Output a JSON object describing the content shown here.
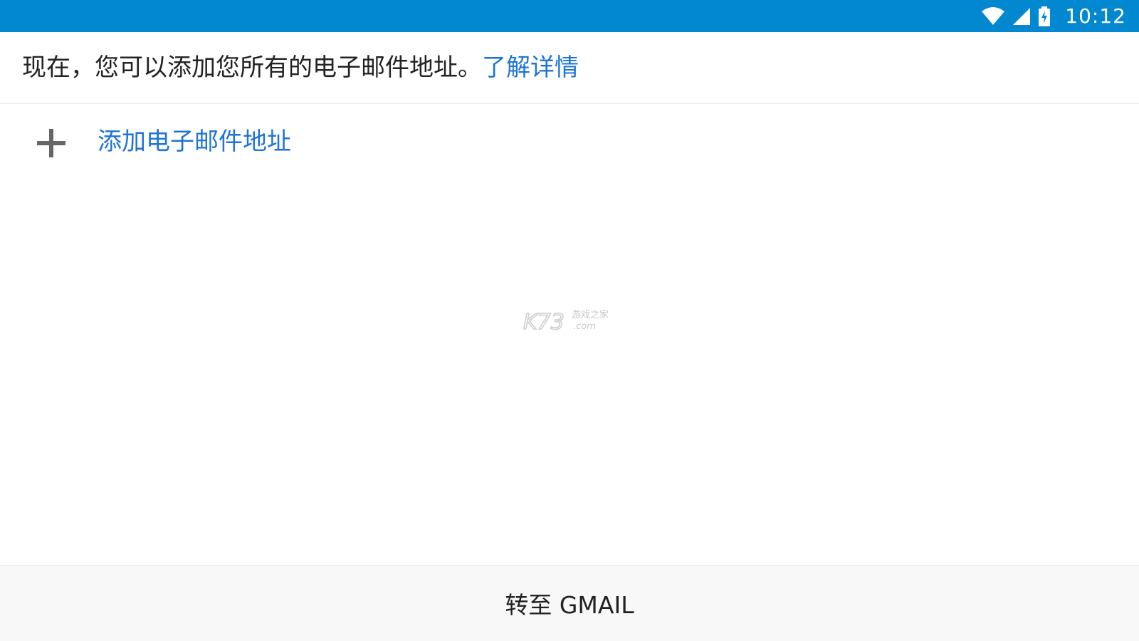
{
  "status_bar": {
    "time": "10:12",
    "background_color": "#0288d1",
    "icons": [
      "wifi-icon",
      "cell-signal-icon",
      "battery-charging-icon"
    ]
  },
  "info": {
    "text": "现在，您可以添加您所有的电子邮件地址。",
    "link_label": "了解详情"
  },
  "add_account": {
    "icon": "plus-icon",
    "label": "添加电子邮件地址"
  },
  "watermark": {
    "logo_text": "K73",
    "tagline": "游戏之家",
    "domain": ".com"
  },
  "footer": {
    "button_label": "转至 GMAIL"
  },
  "colors": {
    "accent": "#1e73d6",
    "text": "#222222",
    "footer_bg": "#f8f8f8"
  }
}
